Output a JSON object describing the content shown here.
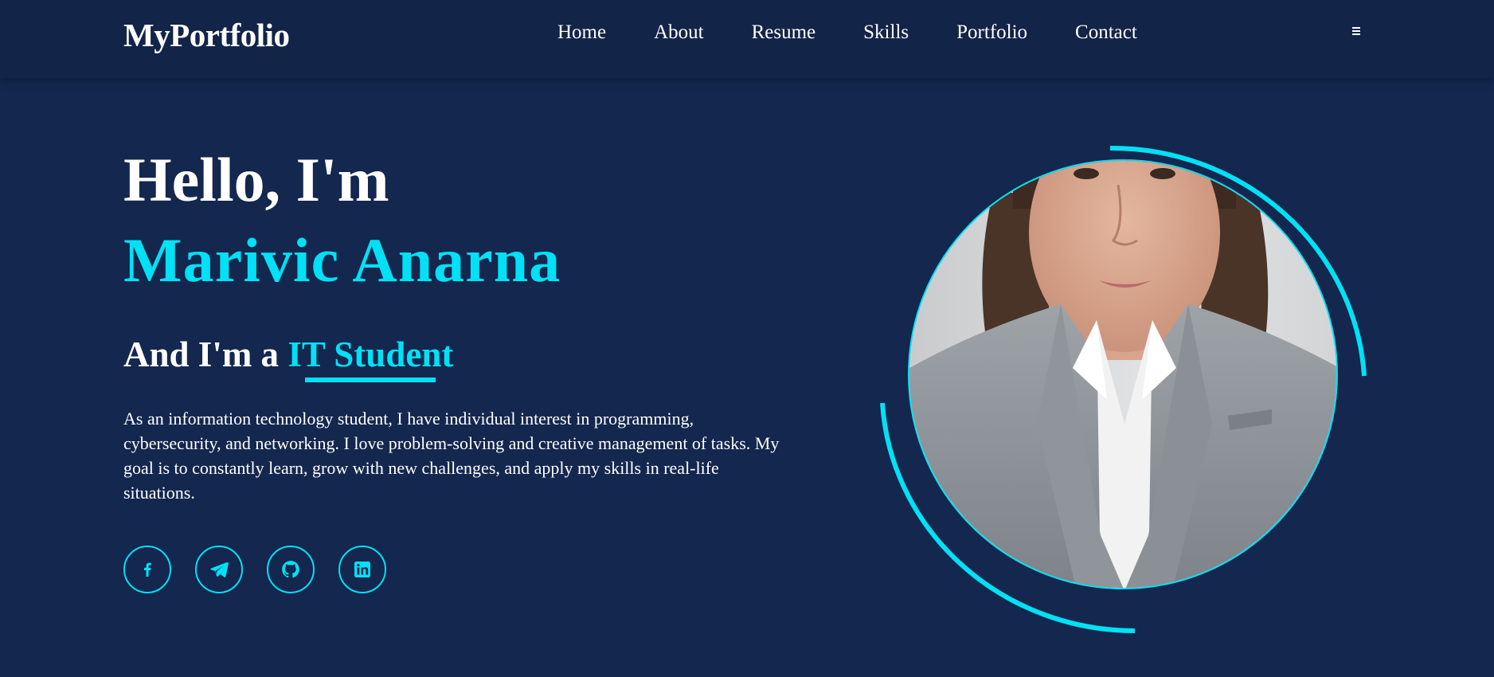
{
  "header": {
    "logo": "MyPortfolio",
    "nav": [
      "Home",
      "About",
      "Resume",
      "Skills",
      "Portfolio",
      "Contact"
    ],
    "menu_icon": "hamburger-menu-icon"
  },
  "hero": {
    "greeting": "Hello, I'm",
    "name": "Marivic Anarna",
    "role_prefix": "And I'm a",
    "role": "IT Student",
    "bio": "As an information technology student, I have individual interest in programming, cybersecurity, and networking. I love problem-solving and creative management of tasks. My goal is to constantly learn, grow with new challenges, and apply my skills in real-life situations.",
    "socials": [
      {
        "icon": "facebook-icon"
      },
      {
        "icon": "telegram-icon"
      },
      {
        "icon": "github-icon"
      },
      {
        "icon": "linkedin-icon"
      }
    ]
  },
  "colors": {
    "background": "#13274f",
    "header_bg": "#122448",
    "accent": "#00e1f5",
    "text": "#ffffff"
  }
}
